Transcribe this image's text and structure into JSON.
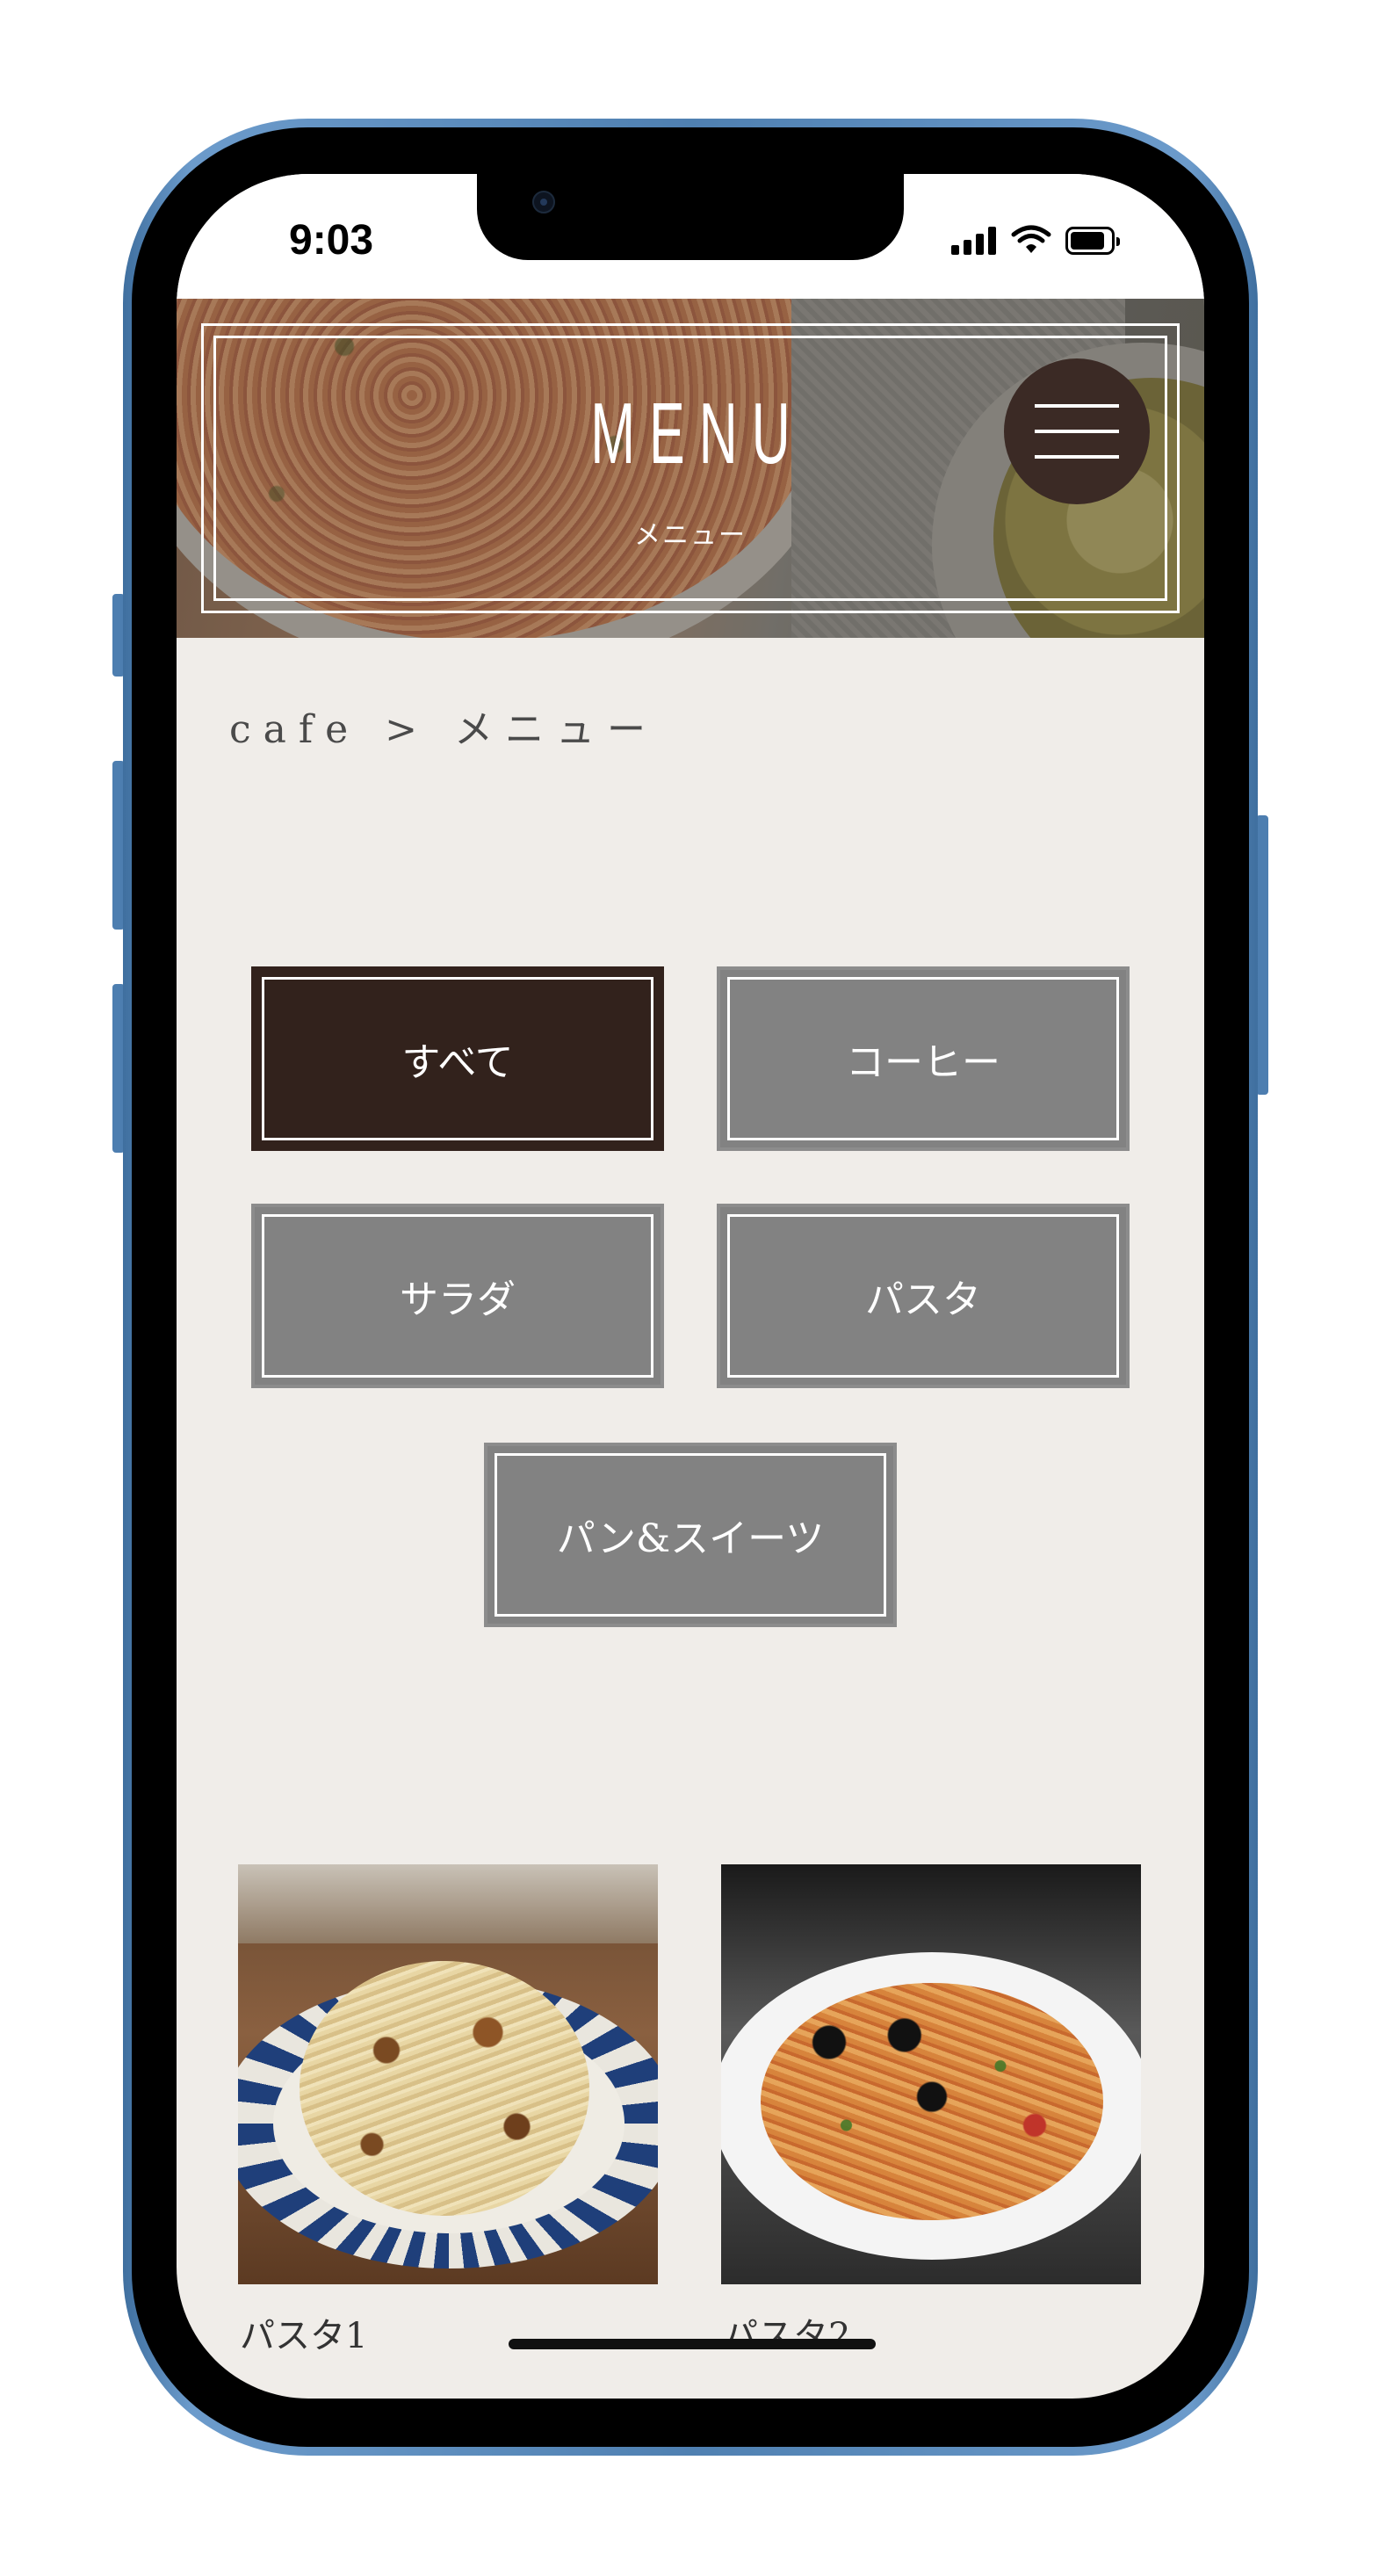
{
  "status_bar": {
    "time": "9:03",
    "icons": [
      "cellular-signal-icon",
      "wifi-icon",
      "battery-icon"
    ]
  },
  "header": {
    "title": "MENU",
    "subtitle": "メニュー",
    "menu_button_icon": "hamburger-menu-icon"
  },
  "breadcrumb": {
    "text": "cafe > メニュー"
  },
  "categories": [
    {
      "label": "すべて",
      "active": true
    },
    {
      "label": "コーヒー",
      "active": false
    },
    {
      "label": "サラダ",
      "active": false
    },
    {
      "label": "パスタ",
      "active": false
    },
    {
      "label": "パン&スイーツ",
      "active": false
    }
  ],
  "items": [
    {
      "name": "パスタ1"
    },
    {
      "name": "パスタ2"
    }
  ],
  "colors": {
    "page_background": "#f0ede9",
    "active_category": "#32221c",
    "inactive_category": "#828282",
    "device_frame": "#4f80b1"
  }
}
